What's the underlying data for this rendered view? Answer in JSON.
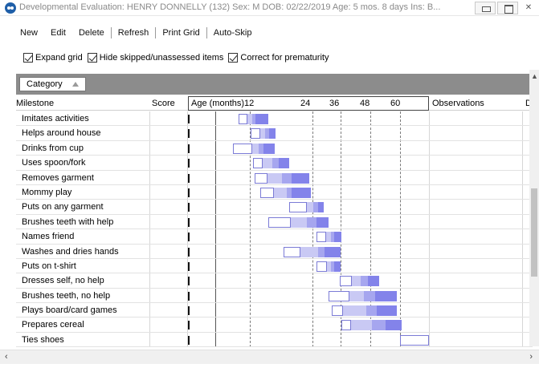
{
  "window": {
    "title": "Developmental Evaluation: HENRY DONNELLY (132)  Sex: M  DOB: 02/22/2019  Age: 5 mos. 8 days  Ins: B..."
  },
  "menu": [
    "New",
    "Edit",
    "Delete",
    "Refresh",
    "Print Grid",
    "Auto-Skip"
  ],
  "options": [
    {
      "label": "Expand grid",
      "checked": true
    },
    {
      "label": "Hide skipped/unassessed items",
      "checked": true
    },
    {
      "label": "Correct for prematurity",
      "checked": true
    }
  ],
  "group_by": {
    "label": "Category"
  },
  "columns": {
    "milestone": "Milestone",
    "score": "Score",
    "age": "Age (months)",
    "observations": "Observations",
    "next": "D"
  },
  "age_ticks": [
    "12",
    "24",
    "36",
    "48",
    "60"
  ],
  "milestones": [
    {
      "name": "Imitates activities"
    },
    {
      "name": "Helps around house"
    },
    {
      "name": "Drinks from cup"
    },
    {
      "name": "Uses spoon/fork"
    },
    {
      "name": "Removes garment"
    },
    {
      "name": "Mommy play"
    },
    {
      "name": "Puts on any garment"
    },
    {
      "name": "Brushes teeth with help"
    },
    {
      "name": "Names friend"
    },
    {
      "name": "Washes and dries hands"
    },
    {
      "name": "Puts on t-shirt"
    },
    {
      "name": "Dresses self, no help"
    },
    {
      "name": "Brushes teeth, no help"
    },
    {
      "name": "Plays board/card games"
    },
    {
      "name": "Prepares cereal"
    },
    {
      "name": "Ties shoes"
    }
  ],
  "colors": {
    "bar_light": "#c9c9f4",
    "bar_mid": "#a6a6ef",
    "bar_dark": "#8383ea",
    "groupbar": "#8c8c8c"
  }
}
